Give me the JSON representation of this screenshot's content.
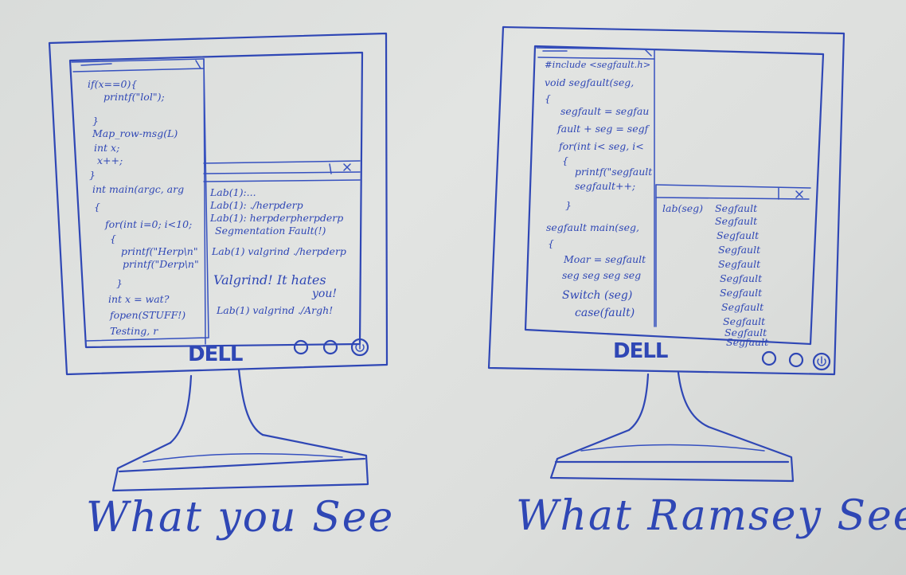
{
  "left_monitor": {
    "logo": "DELL",
    "code_lines": [
      "if(x==0){",
      "printf(\"lol\");",
      "}",
      "Map_row-msg(L)",
      "int x;",
      "x++;",
      "}",
      "int main(argc, arg",
      "{",
      "for(int i=0; i<10;",
      "{",
      "printf(\"Herp\\n\"",
      "printf(\"Derp\\n\"",
      "}",
      "int x = wat?",
      "fopen(STUFF!)",
      "Testing, r"
    ],
    "terminal_lines": [
      "Lab(1):...",
      "Lab(1): ./herpderp",
      "Lab(1): herpderpherpderp",
      "Segmentation Fault(!)",
      "Lab(1) valgrind ./herpderp",
      "Valgrind! It hates",
      "you!",
      "Lab(1) valgrind ./Argh!"
    ]
  },
  "right_monitor": {
    "logo": "DELL",
    "code_lines": [
      "#include <segfault.h>",
      "void segfault(seg,",
      "{",
      "segfault = segfau",
      "fault + seg = segf",
      "for(int i< seg, i<",
      "{",
      "printf(\"segfault",
      "segfault++;",
      "}",
      "segfault main(seg,",
      "{",
      "Moar = segfault",
      "seg seg seg seg",
      "Switch (seg)",
      "case(fault)"
    ],
    "terminal_prompt": "lab(seg)",
    "terminal_lines": [
      "Segfault",
      "Segfault",
      "Segfault",
      "Segfault",
      "Segfault",
      "Segfault",
      "Segfault",
      "Segfault",
      "Segfault",
      "Segfault",
      "Segfault"
    ]
  },
  "captions": {
    "left": "What you See",
    "right": "What Ramsey Sees"
  }
}
